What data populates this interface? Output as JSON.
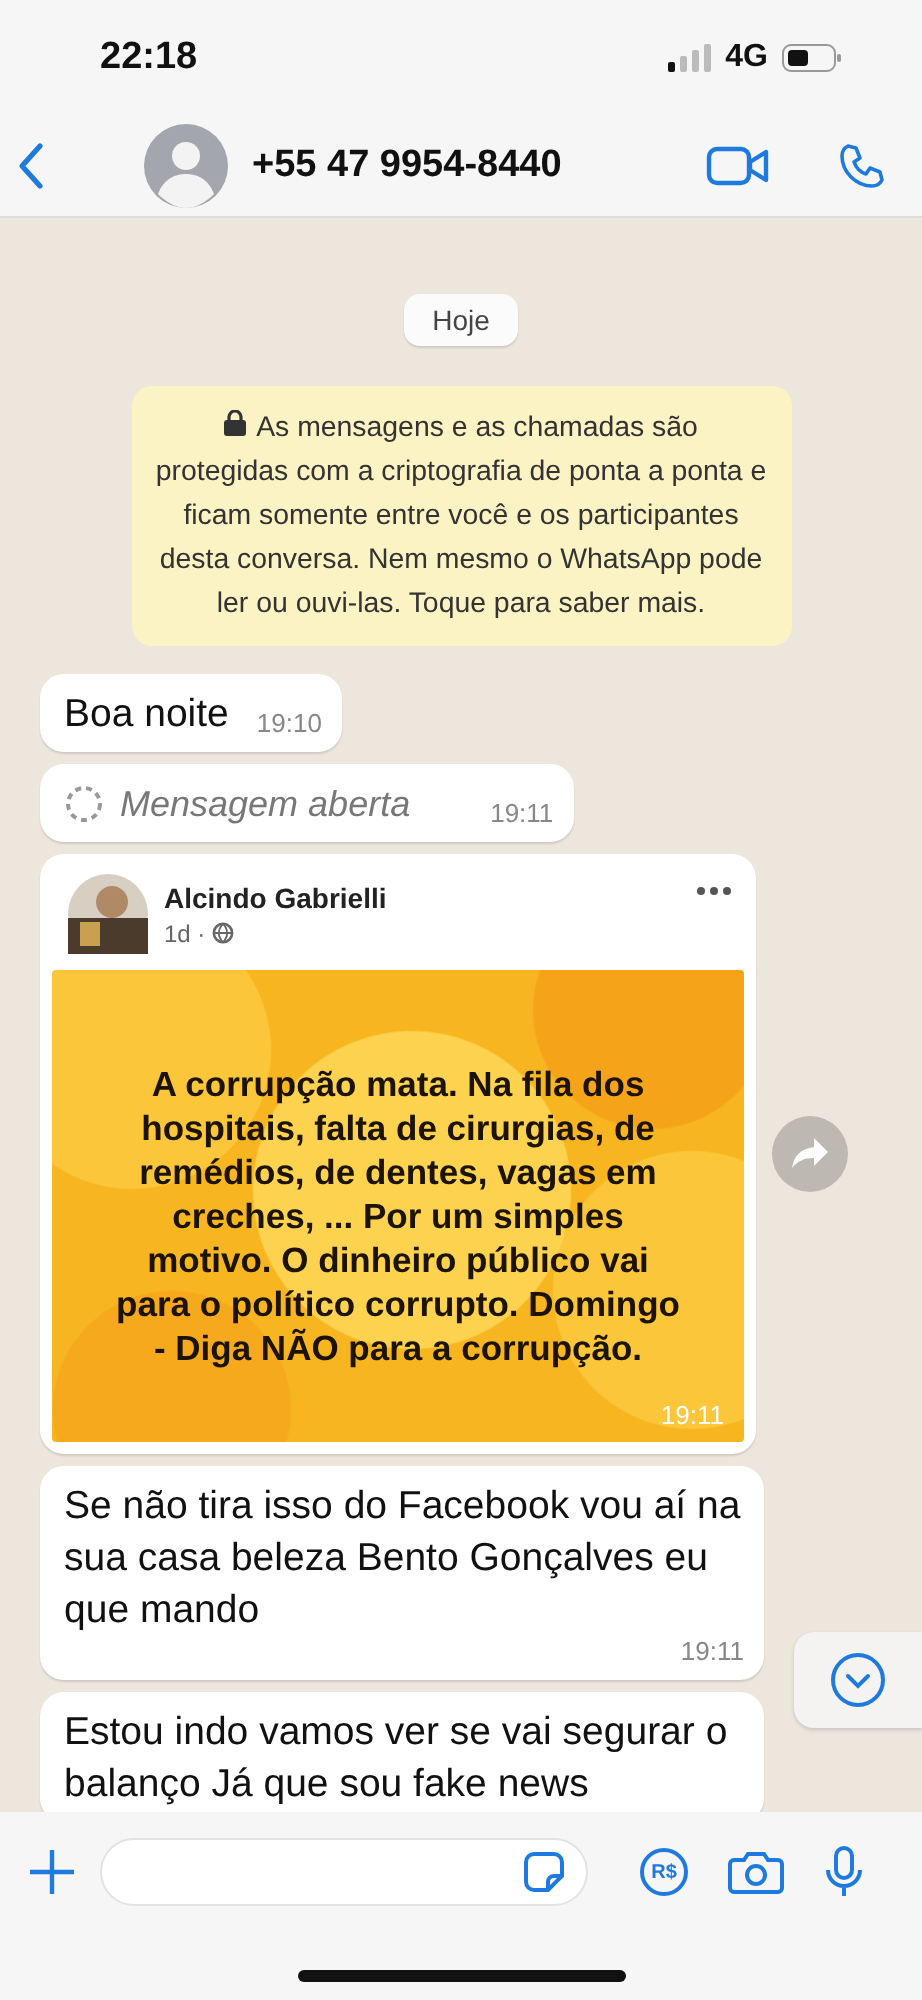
{
  "status_bar": {
    "time": "22:18",
    "network": "4G"
  },
  "header": {
    "contact": "+55 47 9954-8440"
  },
  "date_chip": "Hoje",
  "encryption_notice": "As mensagens e as chamadas são protegidas com a criptografia de ponta a ponta e ficam somente entre você e os participantes desta conversa. Nem mesmo o WhatsApp pode ler ou ouvi-las. Toque para saber mais.",
  "messages": [
    {
      "kind": "text",
      "text": "Boa noite",
      "time": "19:10"
    },
    {
      "kind": "opened",
      "text": "Mensagem aberta",
      "time": "19:11"
    },
    {
      "kind": "post",
      "author": "Alcindo Gabrielli",
      "age": "1d ·",
      "post_text": "A corrupção mata. Na fila dos hospitais, falta de cirurgias, de remédios, de dentes, vagas em creches, ... Por um simples motivo. O dinheiro público vai para o político corrupto. Domingo - Diga NÃO para a corrupção.",
      "time": "19:11"
    },
    {
      "kind": "text",
      "text": "Se não tira isso do Facebook vou aí na sua casa beleza Bento Gonçalves eu que mando",
      "time": "19:11"
    },
    {
      "kind": "text",
      "text": "Estou indo vamos ver se vai segurar o balanço Já que sou fake news"
    }
  ],
  "composer": {
    "pay_label": "R$"
  }
}
